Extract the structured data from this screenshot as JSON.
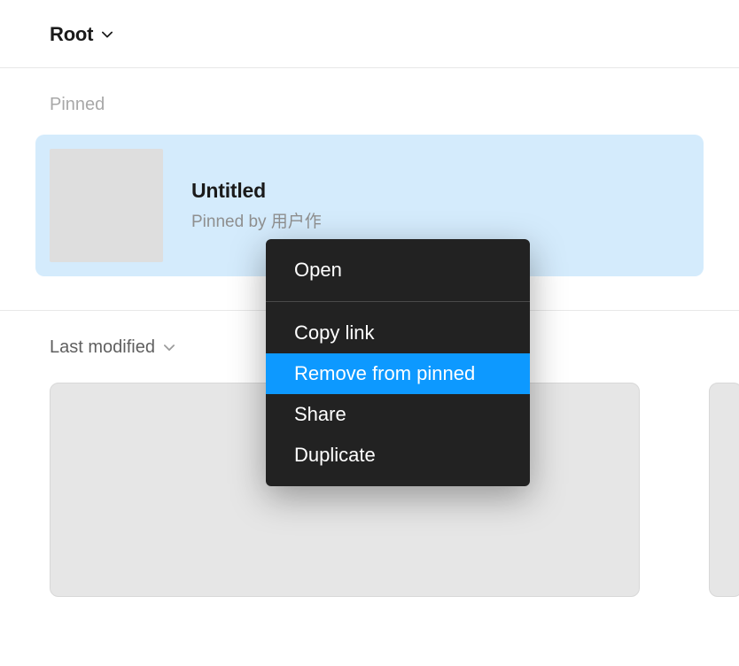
{
  "breadcrumb": {
    "label": "Root"
  },
  "pinned": {
    "section_title": "Pinned",
    "card": {
      "title": "Untitled",
      "subtitle": "Pinned by 用户作"
    }
  },
  "sort": {
    "label": "Last modified"
  },
  "context_menu": {
    "items": [
      {
        "label": "Open"
      },
      {
        "label": "Copy link"
      },
      {
        "label": "Remove from pinned"
      },
      {
        "label": "Share"
      },
      {
        "label": "Duplicate"
      }
    ]
  },
  "colors": {
    "accent": "#0d99ff",
    "pinned_bg": "#d4ebfc"
  }
}
